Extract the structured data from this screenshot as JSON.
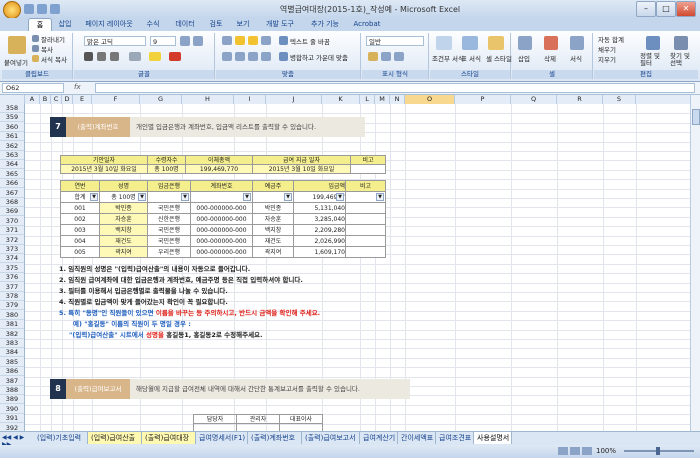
{
  "window": {
    "title": "역별급여대장(2015-1호)_작성예 - Microsoft Excel",
    "minimize": "–",
    "maximize": "□",
    "close": "✕"
  },
  "ribbon_tabs": [
    "홈",
    "삽입",
    "페이지 레이아웃",
    "수식",
    "데이터",
    "검토",
    "보기",
    "개발 도구",
    "추가 기능",
    "Acrobat"
  ],
  "ribbon": {
    "clipboard": {
      "paste": "붙여넣기",
      "cut": "잘라내기",
      "copy": "복사",
      "format_painter": "서식 복사",
      "label": "클립보드"
    },
    "font": {
      "name": "맑은 고딕",
      "size": "9",
      "label": "글꼴"
    },
    "alignment": {
      "wrap": "텍스트 줄 바꿈",
      "merge": "병합하고 가운데 맞춤",
      "label": "맞춤"
    },
    "number": {
      "format": "일반",
      "label": "표시 형식"
    },
    "styles": {
      "conditional": "조건부 서식",
      "table": "표 서식",
      "cell": "셀 스타일",
      "label": "스타일"
    },
    "cells": {
      "insert": "삽입",
      "delete": "삭제",
      "format": "서식",
      "label": "셀"
    },
    "editing": {
      "autosum": "자동 합계",
      "fill": "채우기",
      "clear": "지우기",
      "sort": "정렬 및 필터",
      "find": "찾기 및 선택",
      "label": "편집"
    }
  },
  "formula_bar": {
    "name_box": "O62",
    "fx": "fx",
    "formula": ""
  },
  "columns": [
    "A",
    "B",
    "C",
    "D",
    "E",
    "F",
    "G",
    "H",
    "I",
    "J",
    "K",
    "L",
    "M",
    "N",
    "O",
    "P",
    "Q",
    "R",
    "S"
  ],
  "selected_column": "O",
  "rows": [
    "358",
    "359",
    "360",
    "361",
    "362",
    "363",
    "364",
    "365",
    "366",
    "367",
    "368",
    "369",
    "370",
    "371",
    "372",
    "373",
    "374",
    "375",
    "376",
    "377",
    "378",
    "379",
    "380",
    "381",
    "382",
    "383",
    "384",
    "385",
    "386",
    "387",
    "388",
    "389",
    "390",
    "391",
    "392"
  ],
  "section7": {
    "num": "7",
    "tab": "(출력)계좌번호",
    "desc": "개인별 입금은행과 계좌번호, 입금액 리스트를 출력할 수 있습니다.",
    "summary_headers": [
      "기안일자",
      "수령자수",
      "이체총액",
      "급여 지급 일자",
      "비고"
    ],
    "summary_values": [
      "2015년 3월 10일 화요일",
      "총 100명",
      "199,469,770",
      "2015년 3월 10일 화요일",
      ""
    ],
    "table_headers": [
      "연번",
      "성명",
      "입금은행",
      "계좌번호",
      "예금주",
      "입금액",
      "비고"
    ],
    "filter_row": [
      "합계",
      "총 100명",
      "",
      "",
      "",
      "199,46977",
      ""
    ],
    "table_rows": [
      [
        "001",
        "박민종",
        "국민은행",
        "000-000000-000",
        "박민종",
        "5,131,040",
        ""
      ],
      [
        "002",
        "자승훈",
        "신한은행",
        "000-000000-000",
        "자승훈",
        "3,285,040",
        ""
      ],
      [
        "003",
        "백지창",
        "국민은행",
        "000-000000-000",
        "백지창",
        "2,209,280",
        ""
      ],
      [
        "004",
        "재건도",
        "국민은행",
        "000-000000-000",
        "재건도",
        "2,026,990",
        ""
      ],
      [
        "005",
        "곽지여",
        "우리은행",
        "000-000000-000",
        "곽지여",
        "1,609,170",
        ""
      ]
    ],
    "notes": [
      "1. 임직원의 성명은 \"(입력)급여산출\"의 내용이 자동으로 들어갑니다.",
      "2. 임직원 급여계좌에 대한 입금은행과 계좌번호, 예금주명 등은 직접 입력하셔야 합니다.",
      "3. 필터를 이용해서 입금은행별로 출력물을 나눌 수 있습니다.",
      "4. 직원별로 입금액이 맞게 들어갔는지 확인이 꼭 필요합니다."
    ],
    "note5_a": "5. 특히 \"동명\"인 직원들이 있으면 ",
    "note5_b": "이름을 바꾸는 등 주의하시고, 반드시 금액을 확인해 주세요.",
    "note5_ex1": "예) \"홍길동\" 이름의 직원이 두 명일 경우 :",
    "note5_ex2a": "\"(입력)급여산출\" 시트에서 ",
    "note5_ex2b": "성명을 ",
    "note5_ex2c": "홍길동1, 홍길동2로 수정해주세요."
  },
  "section8": {
    "num": "8",
    "tab": "(출력)급여보고서",
    "desc": "해당월에 지급할 급여전체 내역에 대해서 간단한 통계보고서를 출력할 수 있습니다.",
    "approval": [
      "담당자",
      "관리자",
      "대표이사"
    ]
  },
  "sheet_tabs": [
    "(입력)기초입력",
    "(입력)급여산출",
    "(출력)급여대장",
    "급여명세서(F1)",
    "(출력)계좌번호",
    "(출력)급여보고서",
    "급여계산기",
    "간이세액표",
    "급여조견표",
    "사용설명서"
  ],
  "active_sheet_tab": 9,
  "status": {
    "zoom": "100%"
  },
  "colors": {
    "banner_dark": "#22334f",
    "banner_tab": "#d9b68a",
    "header_fill": "#f4ee8c",
    "row_fill": "#fff9b8",
    "accent_red": "#e0201a",
    "accent_blue": "#1f5fbf"
  }
}
